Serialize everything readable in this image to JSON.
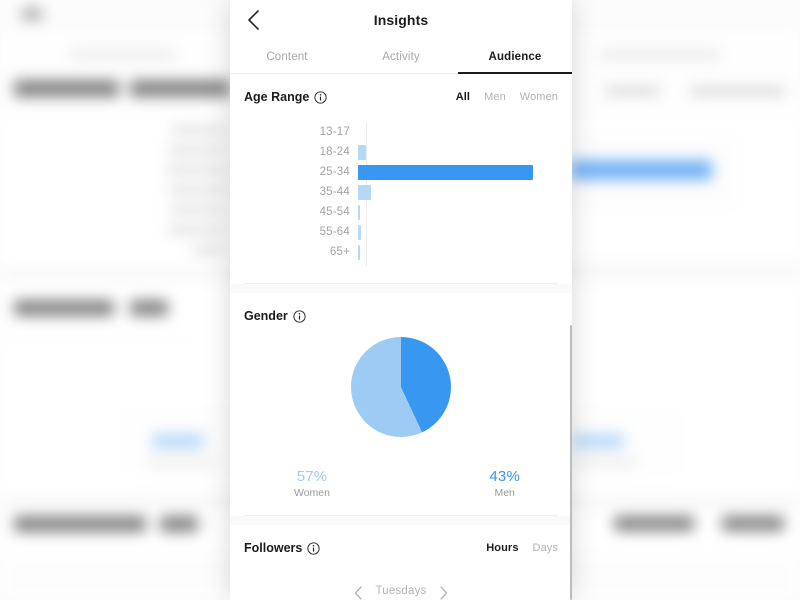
{
  "nav": {
    "title": "Insights",
    "back_icon": "chevron-left-icon"
  },
  "tabs": [
    {
      "label": "Content",
      "active": false
    },
    {
      "label": "Activity",
      "active": false
    },
    {
      "label": "Audience",
      "active": true
    }
  ],
  "age_section": {
    "title": "Age Range",
    "info_icon": "info-circle-icon",
    "filters": [
      {
        "label": "All",
        "active": true
      },
      {
        "label": "Men",
        "active": false
      },
      {
        "label": "Women",
        "active": false
      }
    ]
  },
  "gender_section": {
    "title": "Gender",
    "info_icon": "info-circle-icon",
    "women": {
      "value": "57%",
      "label": "Women"
    },
    "men": {
      "value": "43%",
      "label": "Men"
    }
  },
  "followers_section": {
    "title": "Followers",
    "info_icon": "info-circle-icon",
    "toggles": [
      {
        "label": "Hours",
        "active": true
      },
      {
        "label": "Days",
        "active": false
      }
    ],
    "day": "Tuesdays",
    "prev_icon": "chevron-left-icon",
    "next_icon": "chevron-right-icon"
  },
  "colors": {
    "accent": "#3897f0",
    "accent_light": "#b3d9f7",
    "text_primary": "#1c1c1c",
    "text_muted": "#a8a8a8",
    "divider": "#efefef"
  },
  "chart_data": [
    {
      "type": "bar",
      "title": "Age Range",
      "orientation": "horizontal",
      "categories": [
        "13-17",
        "18-24",
        "25-34",
        "35-44",
        "45-54",
        "55-64",
        "65+"
      ],
      "values": [
        0,
        7,
        100,
        8,
        1,
        1.5,
        1
      ],
      "unit": "percent-of-max",
      "highlight_index": 2,
      "xlabel": "",
      "ylabel": "",
      "grid": false,
      "legend": "none"
    },
    {
      "type": "pie",
      "title": "Gender",
      "labels": [
        "Women",
        "Men"
      ],
      "values": [
        57,
        43
      ],
      "value_labels": [
        "57%",
        "43%"
      ],
      "colors": [
        "#9ecbf3",
        "#3897f0"
      ],
      "legend": "below"
    }
  ]
}
